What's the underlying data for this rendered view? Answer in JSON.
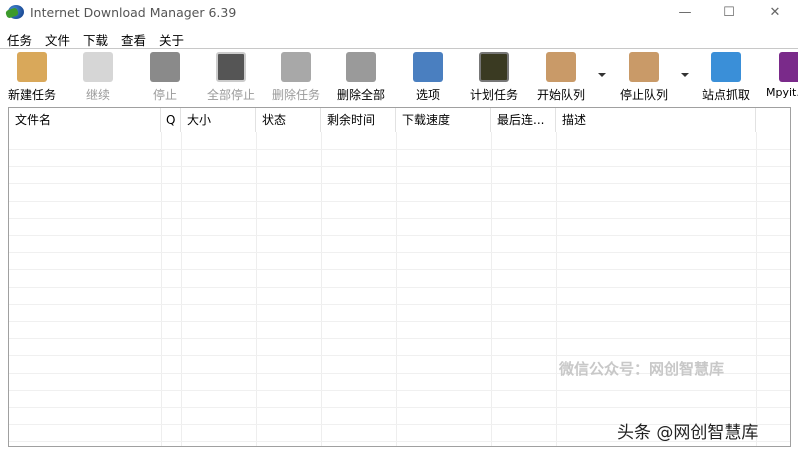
{
  "window": {
    "title": "Internet Download Manager 6.39",
    "minimize": "—",
    "maximize": "☐",
    "close": "✕"
  },
  "menu": [
    "任务",
    "文件",
    "下载",
    "查看",
    "关于"
  ],
  "toolbar": [
    {
      "label": "新建任务",
      "icon": "new-task-icon",
      "enabled": true,
      "color": "#d9a85a"
    },
    {
      "label": "继续",
      "icon": "resume-icon",
      "enabled": false,
      "color": "#d6d6d6"
    },
    {
      "label": "停止",
      "icon": "stop-icon",
      "enabled": false,
      "color": "#8a8a8a"
    },
    {
      "label": "全部停止",
      "icon": "stop-all-icon",
      "enabled": false,
      "color": "#555555"
    },
    {
      "label": "删除任务",
      "icon": "delete-task-icon",
      "enabled": false,
      "color": "#a8a8a8"
    },
    {
      "label": "删除全部",
      "icon": "delete-all-icon",
      "enabled": true,
      "color": "#9a9a9a"
    },
    {
      "label": "选项",
      "icon": "options-icon",
      "enabled": true,
      "color": "#4a7fc0"
    },
    {
      "label": "计划任务",
      "icon": "scheduler-icon",
      "enabled": true,
      "color": "#3a3a22"
    },
    {
      "label": "开始队列",
      "icon": "start-queue-icon",
      "enabled": true,
      "color": "#c99a68"
    },
    {
      "label": "停止队列",
      "icon": "stop-queue-icon",
      "enabled": true,
      "color": "#c99a68"
    },
    {
      "label": "站点抓取",
      "icon": "site-grabber-icon",
      "enabled": true,
      "color": "#3a8fd8"
    },
    {
      "label": "Mpyit...",
      "icon": "mpyit-icon",
      "enabled": true,
      "color": "#7a2a8a"
    }
  ],
  "columns": [
    "文件名",
    "Q",
    "大小",
    "状态",
    "剩余时间",
    "下载速度",
    "最后连...",
    "描述"
  ],
  "watermarks": [
    "微信公众号：网创智慧库",
    "头条 @网创智慧库"
  ]
}
